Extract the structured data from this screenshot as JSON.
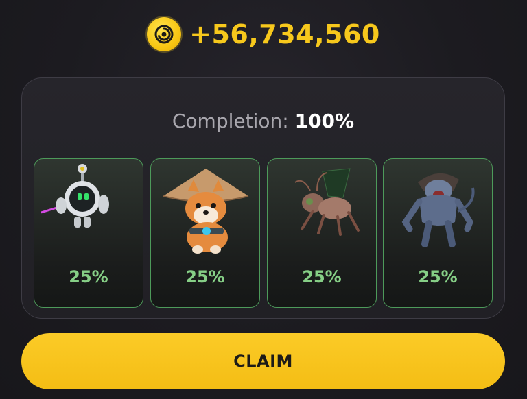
{
  "header": {
    "coin_icon": "coin-icon",
    "amount": "+56,734,560"
  },
  "panel": {
    "completion_label": "Completion:",
    "completion_value": "100%",
    "cards": [
      {
        "name": "robot",
        "icon": "robot-card-icon",
        "percent": "25%",
        "share": 0.25
      },
      {
        "name": "shiba",
        "icon": "shiba-card-icon",
        "percent": "25%",
        "share": 0.25
      },
      {
        "name": "insect",
        "icon": "insect-card-icon",
        "percent": "25%",
        "share": 0.25
      },
      {
        "name": "beast",
        "icon": "beast-card-icon",
        "percent": "25%",
        "share": 0.25
      }
    ]
  },
  "claim_button": {
    "label": "CLAIM"
  },
  "colors": {
    "accent_yellow": "#f7c81c",
    "card_border": "#4d9a5a",
    "card_percent": "#86cf86",
    "background": "#1c1b20"
  }
}
